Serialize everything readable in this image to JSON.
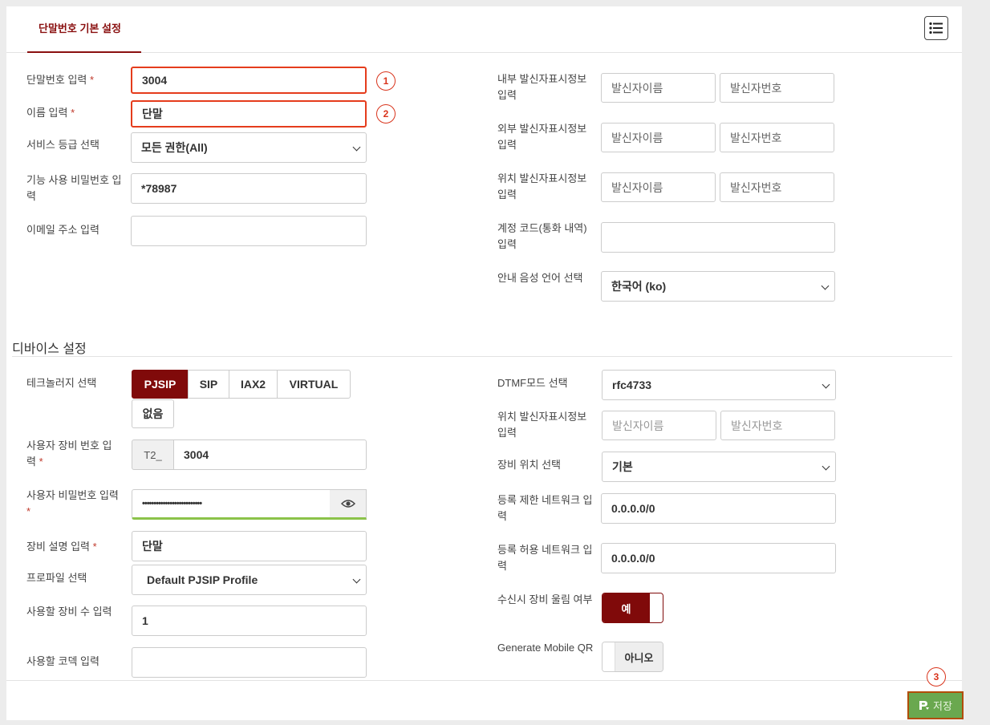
{
  "tab": {
    "label": "단말번호 기본 설정"
  },
  "menu_icon": "list-icon",
  "basic": {
    "extension_label": "단말번호 입력",
    "extension_value": "3004",
    "name_label": "이름 입력",
    "name_value": "단말",
    "service_label": "서비스 등급 선택",
    "service_value": "모든 권한(All)",
    "feature_pw_label": "기능 사용 비밀번호 입력",
    "feature_pw_value": "*78987",
    "email_label": "이메일 주소 입력",
    "email_value": "",
    "required_mark": "*"
  },
  "callerid": {
    "internal_label": "내부 발신자표시정보 입력",
    "external_label": "외부 발신자표시정보 입력",
    "location_label": "위치 발신자표시정보 입력",
    "name_placeholder": "발신자이름",
    "number_placeholder": "발신자번호",
    "account_code_label": "계정 코드(통화 내역) 입력",
    "account_code_value": "",
    "language_label": "안내 음성 언어 선택",
    "language_value": "한국어 (ko)"
  },
  "annotations": {
    "one": "1",
    "two": "2",
    "three": "3"
  },
  "device": {
    "section_title": "디바이스 설정",
    "tech_label": "테크놀러지 선택",
    "tech_options": [
      "PJSIP",
      "SIP",
      "IAX2",
      "VIRTUAL",
      "없음"
    ],
    "tech_selected": "PJSIP",
    "device_id_label": "사용자 장비 번호 입력",
    "device_id_prefix": "T2_",
    "device_id_value": "3004",
    "password_label": "사용자 비밀번호 입력",
    "password_masked": "••••••••••••••••••••••••••",
    "description_label": "장비 설명 입력",
    "description_value": "단말",
    "profile_label": "프로파일 선택",
    "profile_value": "Default PJSIP Profile",
    "count_label": "사용할 장비 수 입력",
    "count_value": "1",
    "codec_label": "사용할 코덱 입력",
    "codec_value": "",
    "dtmf_label": "DTMF모드 선택",
    "dtmf_value": "rfc4733",
    "location_label": "위치 발신자표시정보 입력",
    "location_name_placeholder": "발신자이름",
    "location_number_placeholder": "발신자번호",
    "device_location_label": "장비 위치 선택",
    "device_location_value": "기본",
    "deny_label": "등록 제한 네트워크 입력",
    "deny_value": "0.0.0.0/0",
    "permit_label": "등록 허용 네트워크 입력",
    "permit_value": "0.0.0.0/0",
    "ring_label": "수신시 장비 울림 여부",
    "ring_value": "예",
    "mobile_qr_label": "Generate Mobile QR",
    "mobile_qr_value": "아니오"
  },
  "footer": {
    "save_label": "저장",
    "accent": "#6aa84f"
  },
  "colors": {
    "brand": "#800a0a",
    "highlight": "#e53c1c",
    "password_ok": "#8bc34a"
  }
}
